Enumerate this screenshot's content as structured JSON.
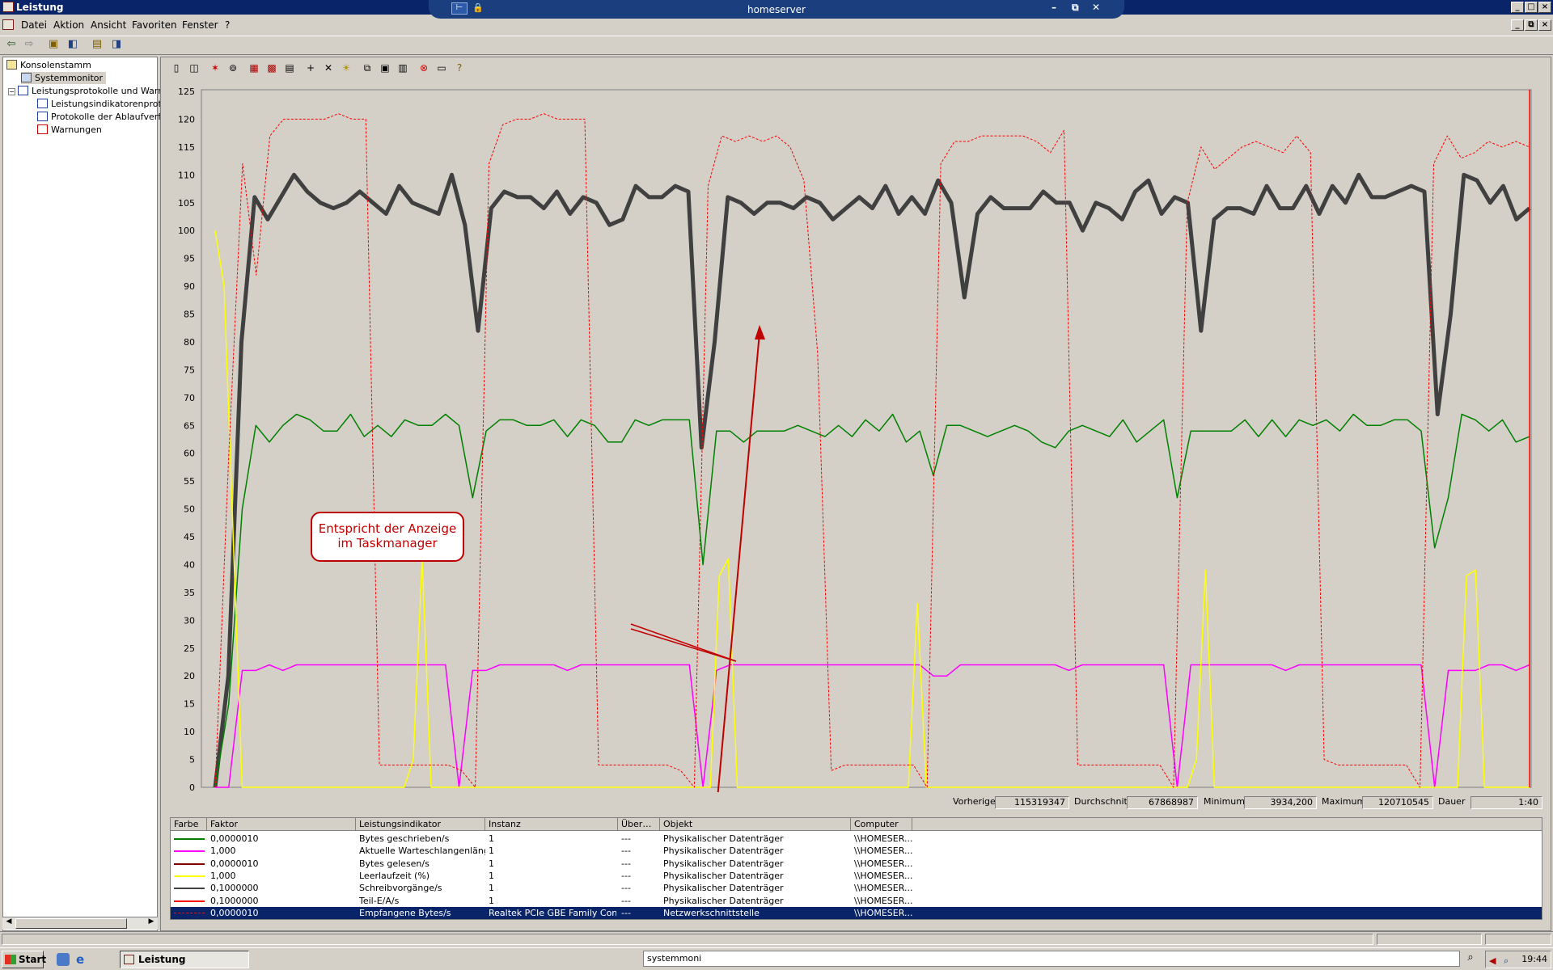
{
  "window": {
    "title": "Leistung"
  },
  "remote_bar": {
    "title": "homeserver"
  },
  "menu": [
    "Datei",
    "Aktion",
    "Ansicht",
    "Favoriten",
    "Fenster",
    "?"
  ],
  "tree": [
    {
      "label": "Konsolenstamm",
      "icon": "folder-icon"
    },
    {
      "label": "Systemmonitor",
      "icon": "monitor-icon"
    },
    {
      "label": "Leistungsprotokolle und Warnu",
      "icon": "logs-icon"
    },
    {
      "label": "Leistungsindikatorenprotok",
      "icon": "chart-icon"
    },
    {
      "label": "Protokolle der Ablaufverfol",
      "icon": "chart-icon"
    },
    {
      "label": "Warnungen",
      "icon": "warning-icon"
    }
  ],
  "stats": {
    "prev_label": "Vorherige",
    "prev_value": "115319347",
    "avg_label": "Durchschnitt",
    "avg_value": "67868987",
    "min_label": "Minimum",
    "min_value": "3934,200",
    "max_label": "Maximum",
    "max_value": "120710545",
    "dur_label": "Dauer",
    "dur_value": "1:40"
  },
  "legend": {
    "columns": [
      "Farbe",
      "Faktor",
      "Leistungsindikator",
      "Instanz",
      "Über…",
      "Objekt",
      "Computer"
    ],
    "rows": [
      {
        "color": "#008000",
        "factor": "0,0000010",
        "counter": "Bytes geschrieben/s",
        "instance": "1",
        "parent": "---",
        "object": "Physikalischer Datenträger",
        "computer": "\\\\HOMESER..."
      },
      {
        "color": "#ff00ff",
        "factor": "1,000",
        "counter": "Aktuelle Warteschlangenlänge",
        "instance": "1",
        "parent": "---",
        "object": "Physikalischer Datenträger",
        "computer": "\\\\HOMESER..."
      },
      {
        "color": "#800000",
        "factor": "0,0000010",
        "counter": "Bytes gelesen/s",
        "instance": "1",
        "parent": "---",
        "object": "Physikalischer Datenträger",
        "computer": "\\\\HOMESER..."
      },
      {
        "color": "#ffff00",
        "factor": "1,000",
        "counter": "Leerlaufzeit (%)",
        "instance": "1",
        "parent": "---",
        "object": "Physikalischer Datenträger",
        "computer": "\\\\HOMESER..."
      },
      {
        "color": "#404040",
        "factor": "0,1000000",
        "counter": "Schreibvorgänge/s",
        "instance": "1",
        "parent": "---",
        "object": "Physikalischer Datenträger",
        "computer": "\\\\HOMESER..."
      },
      {
        "color": "#ff0000",
        "factor": "0,1000000",
        "counter": "Teil-E/A/s",
        "instance": "1",
        "parent": "---",
        "object": "Physikalischer Datenträger",
        "computer": "\\\\HOMESER..."
      },
      {
        "color": "#ff0000",
        "factor": "0,0000010",
        "counter": "Empfangene Bytes/s",
        "instance": "Realtek PCIe GBE Family Cont...",
        "parent": "---",
        "object": "Netzwerkschnittstelle",
        "computer": "\\\\HOMESER...",
        "selected": true
      }
    ]
  },
  "annotation": {
    "line1": "Entspricht der Anzeige",
    "line2": "im Taskmanager"
  },
  "taskbar": {
    "start": "Start",
    "task": "Leistung",
    "address": "systemmoni",
    "clock": "19:44"
  },
  "chart_data": {
    "type": "line",
    "ylim": [
      0,
      125
    ],
    "yticks": [
      0,
      5,
      10,
      15,
      20,
      25,
      30,
      35,
      40,
      45,
      50,
      55,
      60,
      65,
      70,
      75,
      80,
      85,
      90,
      95,
      100,
      105,
      110,
      115,
      120,
      125
    ],
    "grid": false,
    "series": [
      {
        "name": "Schreibvorgänge/s",
        "color": "#404040",
        "width": 5,
        "values": [
          0,
          20,
          80,
          106,
          102,
          106,
          110,
          107,
          105,
          104,
          105,
          107,
          105,
          103,
          108,
          105,
          104,
          103,
          110,
          101,
          82,
          104,
          107,
          106,
          106,
          104,
          107,
          103,
          106,
          105,
          101,
          102,
          108,
          106,
          106,
          108,
          107,
          61,
          80,
          106,
          105,
          103,
          105,
          105,
          104,
          106,
          105,
          102,
          104,
          106,
          104,
          108,
          103,
          106,
          103,
          109,
          105,
          88,
          103,
          106,
          104,
          104,
          104,
          107,
          105,
          105,
          100,
          105,
          104,
          102,
          107,
          109,
          103,
          106,
          105,
          82,
          102,
          104,
          104,
          103,
          108,
          104,
          104,
          108,
          103,
          108,
          105,
          110,
          106,
          106,
          107,
          108,
          107,
          67,
          85,
          110,
          109,
          105,
          108,
          102,
          104
        ]
      },
      {
        "name": "Bytes geschrieben/s",
        "color": "#008000",
        "width": 1.5,
        "values": [
          0,
          15,
          50,
          65,
          62,
          65,
          67,
          66,
          64,
          64,
          67,
          63,
          65,
          63,
          66,
          65,
          65,
          67,
          65,
          52,
          64,
          66,
          66,
          65,
          65,
          66,
          63,
          66,
          65,
          62,
          62,
          66,
          65,
          66,
          66,
          66,
          40,
          64,
          64,
          62,
          64,
          64,
          64,
          65,
          64,
          63,
          65,
          63,
          66,
          64,
          67,
          62,
          64,
          56,
          65,
          65,
          64,
          63,
          64,
          65,
          64,
          62,
          61,
          64,
          65,
          64,
          63,
          66,
          62,
          64,
          66,
          52,
          64,
          64,
          64,
          64,
          66,
          63,
          66,
          63,
          66,
          65,
          66,
          64,
          67,
          65,
          65,
          66,
          66,
          64,
          43,
          52,
          67,
          66,
          64,
          66,
          62,
          63
        ]
      },
      {
        "name": "Aktuelle Warteschlangenlänge",
        "color": "#ff00ff",
        "width": 1.5,
        "values": [
          0,
          0,
          21,
          21,
          22,
          21,
          22,
          22,
          22,
          22,
          22,
          22,
          22,
          22,
          22,
          22,
          22,
          22,
          0,
          21,
          21,
          22,
          22,
          22,
          22,
          22,
          21,
          22,
          22,
          22,
          22,
          22,
          22,
          22,
          22,
          22,
          0,
          21,
          22,
          22,
          22,
          22,
          22,
          22,
          22,
          22,
          22,
          22,
          22,
          22,
          22,
          22,
          22,
          20,
          20,
          22,
          22,
          22,
          22,
          22,
          22,
          22,
          22,
          21,
          22,
          22,
          22,
          22,
          22,
          22,
          22,
          0,
          22,
          22,
          22,
          22,
          22,
          22,
          22,
          21,
          22,
          22,
          22,
          22,
          22,
          22,
          22,
          22,
          22,
          22,
          0,
          21,
          21,
          21,
          22,
          22,
          21,
          22
        ]
      },
      {
        "name": "Leerlaufzeit (%)",
        "color": "#ffff00",
        "width": 1.5,
        "values": [
          100,
          90,
          45,
          0,
          0,
          0,
          0,
          0,
          0,
          0,
          0,
          0,
          0,
          0,
          0,
          0,
          0,
          0,
          0,
          0,
          0,
          0,
          5,
          41,
          0,
          0,
          0,
          0,
          0,
          0,
          0,
          0,
          0,
          0,
          0,
          0,
          0,
          0,
          0,
          0,
          0,
          0,
          0,
          0,
          0,
          0,
          0,
          0,
          0,
          0,
          0,
          0,
          0,
          0,
          0,
          0,
          38,
          41,
          0,
          0,
          0,
          0,
          0,
          0,
          0,
          0,
          0,
          0,
          0,
          0,
          0,
          0,
          0,
          0,
          0,
          0,
          0,
          0,
          33,
          0,
          0,
          0,
          0,
          0,
          0,
          0,
          0,
          0,
          0,
          0,
          0,
          0,
          0,
          0,
          0,
          0,
          0,
          0,
          0,
          0,
          0,
          0,
          0,
          0,
          0,
          0,
          0,
          0,
          0,
          5,
          39,
          0,
          0,
          0,
          0,
          0,
          0,
          0,
          0,
          0,
          0,
          0,
          0,
          0,
          0,
          0,
          0,
          0,
          0,
          0,
          0,
          0,
          0,
          0,
          0,
          0,
          0,
          0,
          0,
          38,
          39,
          0,
          0,
          0,
          0,
          0,
          0
        ]
      },
      {
        "name": "Empfangene Bytes/s",
        "color": "#ff0000",
        "width": 1,
        "dashed": true,
        "values": [
          0,
          60,
          112,
          92,
          117,
          120,
          120,
          120,
          120,
          121,
          120,
          120,
          4,
          4,
          4,
          4,
          4,
          4,
          3,
          0,
          112,
          119,
          120,
          120,
          121,
          120,
          120,
          120,
          4,
          4,
          4,
          4,
          4,
          4,
          3,
          0,
          108,
          117,
          116,
          117,
          116,
          117,
          115,
          109,
          78,
          3,
          4,
          4,
          4,
          4,
          4,
          4,
          0,
          112,
          116,
          116,
          117,
          117,
          117,
          117,
          116,
          114,
          118,
          4,
          4,
          4,
          4,
          4,
          4,
          4,
          0,
          105,
          115,
          111,
          113,
          115,
          116,
          115,
          114,
          117,
          114,
          5,
          4,
          4,
          4,
          4,
          4,
          4,
          0,
          112,
          117,
          113,
          114,
          116,
          115,
          116,
          115
        ]
      }
    ]
  }
}
